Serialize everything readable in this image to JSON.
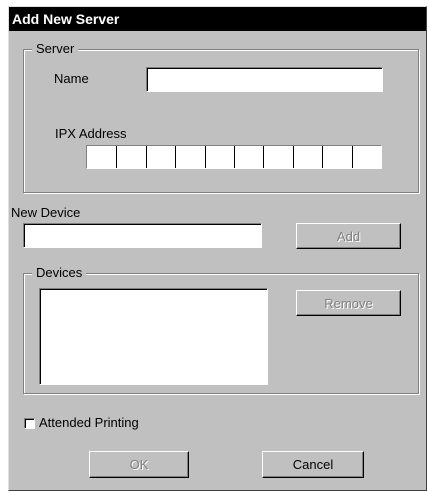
{
  "window": {
    "title": "Add New Server"
  },
  "server_group": {
    "legend": "Server",
    "name_label": "Name",
    "name_value": "",
    "ipx_label": "IPX Address",
    "ipx_cells": [
      "",
      "",
      "",
      "",
      "",
      "",
      "",
      "",
      "",
      ""
    ]
  },
  "new_device": {
    "label": "New Device",
    "value": "",
    "add_label": "Add"
  },
  "devices_group": {
    "legend": "Devices",
    "items": [],
    "remove_label": "Remove"
  },
  "attended_printing": {
    "label": "Attended Printing",
    "checked": false
  },
  "footer": {
    "ok_label": "OK",
    "cancel_label": "Cancel"
  }
}
